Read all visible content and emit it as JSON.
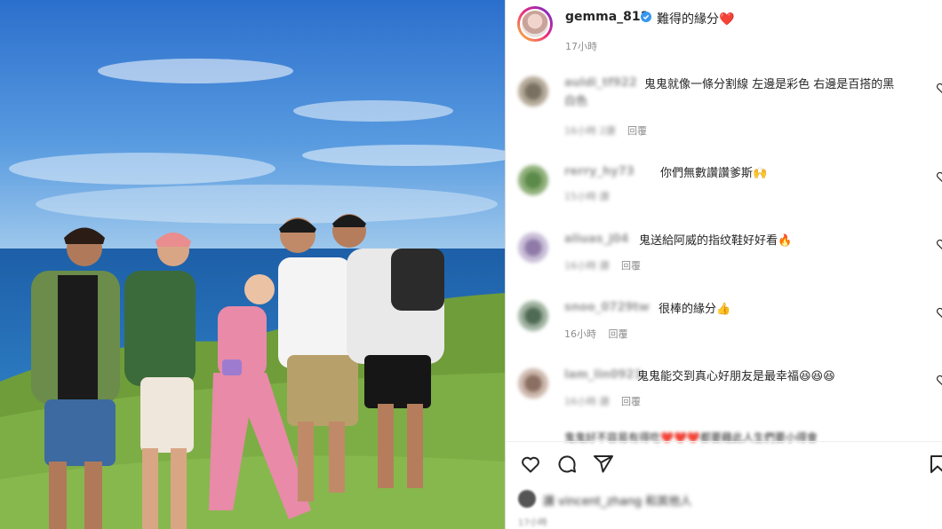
{
  "post": {
    "username": "gemma_811",
    "caption": "難得的緣分❤️",
    "time": "17小時"
  },
  "comments": [
    {
      "user": "auldi_tf922",
      "text": "鬼鬼就像一條分割線 左邊是彩色 右邊是百搭的黑",
      "text2": "白色",
      "meta": "16小時  2讚",
      "reply": "回覆"
    },
    {
      "user": "rerry_hy73",
      "text": "你們無數讚讚爹斯🙌",
      "text2": "",
      "meta": "15小時  讚",
      "reply": ""
    },
    {
      "user": "aliuas_j04",
      "text": "鬼送給阿威的指纹鞋好好看🔥",
      "text2": "",
      "meta": "16小時  讚",
      "reply": "回覆"
    },
    {
      "user": "snoo_0729tw",
      "text": "很棒的緣分👍",
      "text2": "",
      "meta": "16小時",
      "reply": "回覆"
    },
    {
      "user": "lam_lin0921",
      "text": "鬼鬼能交到真心好朋友是最幸福😆😆😆",
      "text2": "",
      "meta": "16小時  讚",
      "reply": "回覆"
    }
  ],
  "partial_comment": "鬼鬼好不容易有得吃❤️❤️❤️都要藉此人生們要小得會",
  "likes_text": "讚 vincent_zhang 和其他人",
  "bottom_time": "17小時",
  "colors": {
    "verified": "#3897f0",
    "heart": "#ed4956",
    "sky": "#3a7fd3",
    "grass": "#6f9d3a"
  }
}
